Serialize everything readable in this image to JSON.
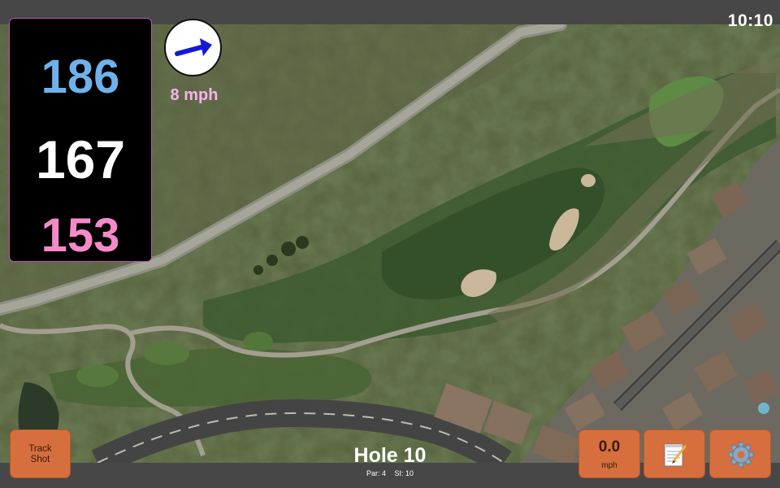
{
  "status_bar": {
    "time": "10:10"
  },
  "distances": {
    "back": "186",
    "center": "167",
    "front": "153"
  },
  "wind": {
    "speed_label": "8 mph",
    "direction_icon": "arrow-east-icon"
  },
  "hole": {
    "title": "Hole 10",
    "par": "Par: 4",
    "stroke_index": "SI: 10"
  },
  "buttons": {
    "track_shot": {
      "line1": "Track",
      "line2": "Shot"
    },
    "wind_readout": {
      "value": "0.0",
      "unit": "mph"
    },
    "notes_icon": "notepad-icon",
    "settings_icon": "gear-icon"
  },
  "colors": {
    "back_distance": "#6eb2ec",
    "center_distance": "#ffffff",
    "front_distance": "#f58ac9",
    "button": "#d66e3e",
    "panel_border": "#c24fb7"
  }
}
